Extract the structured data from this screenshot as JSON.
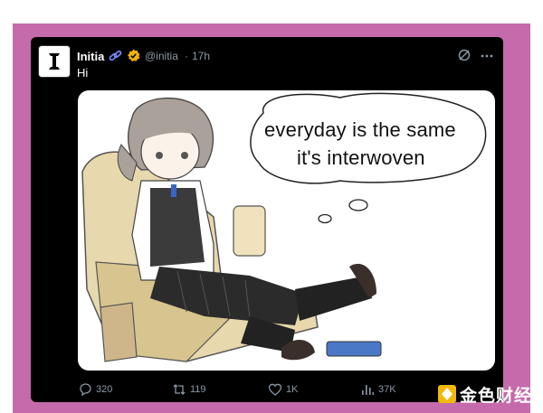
{
  "tweet": {
    "author_name": "Initia",
    "handle": "@initia",
    "separator": "·",
    "time": "17h",
    "text": "Hi"
  },
  "media": {
    "speech_line1": "everyday is the same",
    "speech_line2": "it's interwoven"
  },
  "actions": {
    "replies": "320",
    "reposts": "119",
    "likes": "1K",
    "views": "37K"
  },
  "watermark": {
    "text": "金色财经"
  },
  "icons": [
    "initia-logo-icon",
    "chain-icon",
    "verified-icon",
    "grok-icon",
    "more-icon",
    "reply-icon",
    "repost-icon",
    "like-icon",
    "views-icon"
  ],
  "colors": {
    "frame": "#c56aaa",
    "card": "#000000",
    "muted": "#8b98a5",
    "verified": "#f4b400",
    "chain": "#7a8cff"
  }
}
